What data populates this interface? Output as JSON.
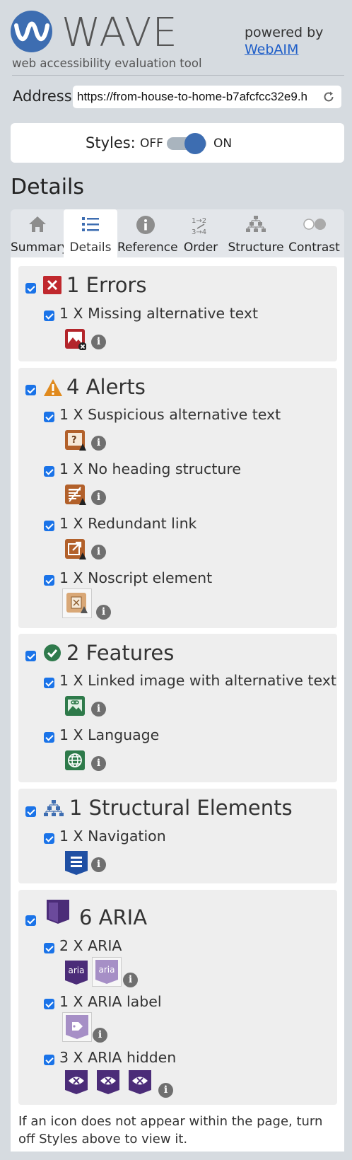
{
  "header": {
    "logo_text": "WAVE",
    "tagline": "web accessibility evaluation tool",
    "powered_by": "powered by",
    "webaim_link": "WebAIM"
  },
  "address": {
    "label": "Address:",
    "value": "https://from-house-to-home-b7afcfcc32e9.h"
  },
  "styles": {
    "label": "Styles:",
    "off": "OFF",
    "on": "ON",
    "state": "on"
  },
  "page_heading": "Details",
  "tabs": [
    {
      "label": "Summary",
      "icon": "home-icon",
      "active": false
    },
    {
      "label": "Details",
      "icon": "list-icon",
      "active": true
    },
    {
      "label": "Reference",
      "icon": "info-icon",
      "active": false
    },
    {
      "label": "Order",
      "icon": "order-icon",
      "active": false
    },
    {
      "label": "Structure",
      "icon": "structure-icon",
      "active": false
    },
    {
      "label": "Contrast",
      "icon": "contrast-icon",
      "active": false
    }
  ],
  "sections": {
    "errors": {
      "title": "1 Errors",
      "items": [
        {
          "label": "1 X Missing alternative text"
        }
      ]
    },
    "alerts": {
      "title": "4 Alerts",
      "items": [
        {
          "label": "1 X Suspicious alternative text"
        },
        {
          "label": "1 X No heading structure"
        },
        {
          "label": "1 X Redundant link"
        },
        {
          "label": "1 X Noscript element"
        }
      ]
    },
    "features": {
      "title": "2 Features",
      "items": [
        {
          "label": "1 X Linked image with alternative text"
        },
        {
          "label": "1 X Language"
        }
      ]
    },
    "structure": {
      "title": "1 Structural Elements",
      "items": [
        {
          "label": "1 X Navigation"
        }
      ]
    },
    "aria": {
      "title": "6 ARIA",
      "items": [
        {
          "label": "2 X ARIA",
          "icon_text": "aria"
        },
        {
          "label": "1 X ARIA label"
        },
        {
          "label": "3 X ARIA hidden"
        }
      ]
    }
  },
  "info_glyph": "i",
  "footnote": "If an icon does not appear within the page, turn off Styles above to view it.",
  "colors": {
    "brand_blue": "#3d6db1",
    "error_red": "#c0282d",
    "alert_orange": "#e08a1e",
    "feature_green": "#2f7a4c",
    "structure_blue": "#1f4fa3",
    "aria_purple": "#4b2c78"
  }
}
